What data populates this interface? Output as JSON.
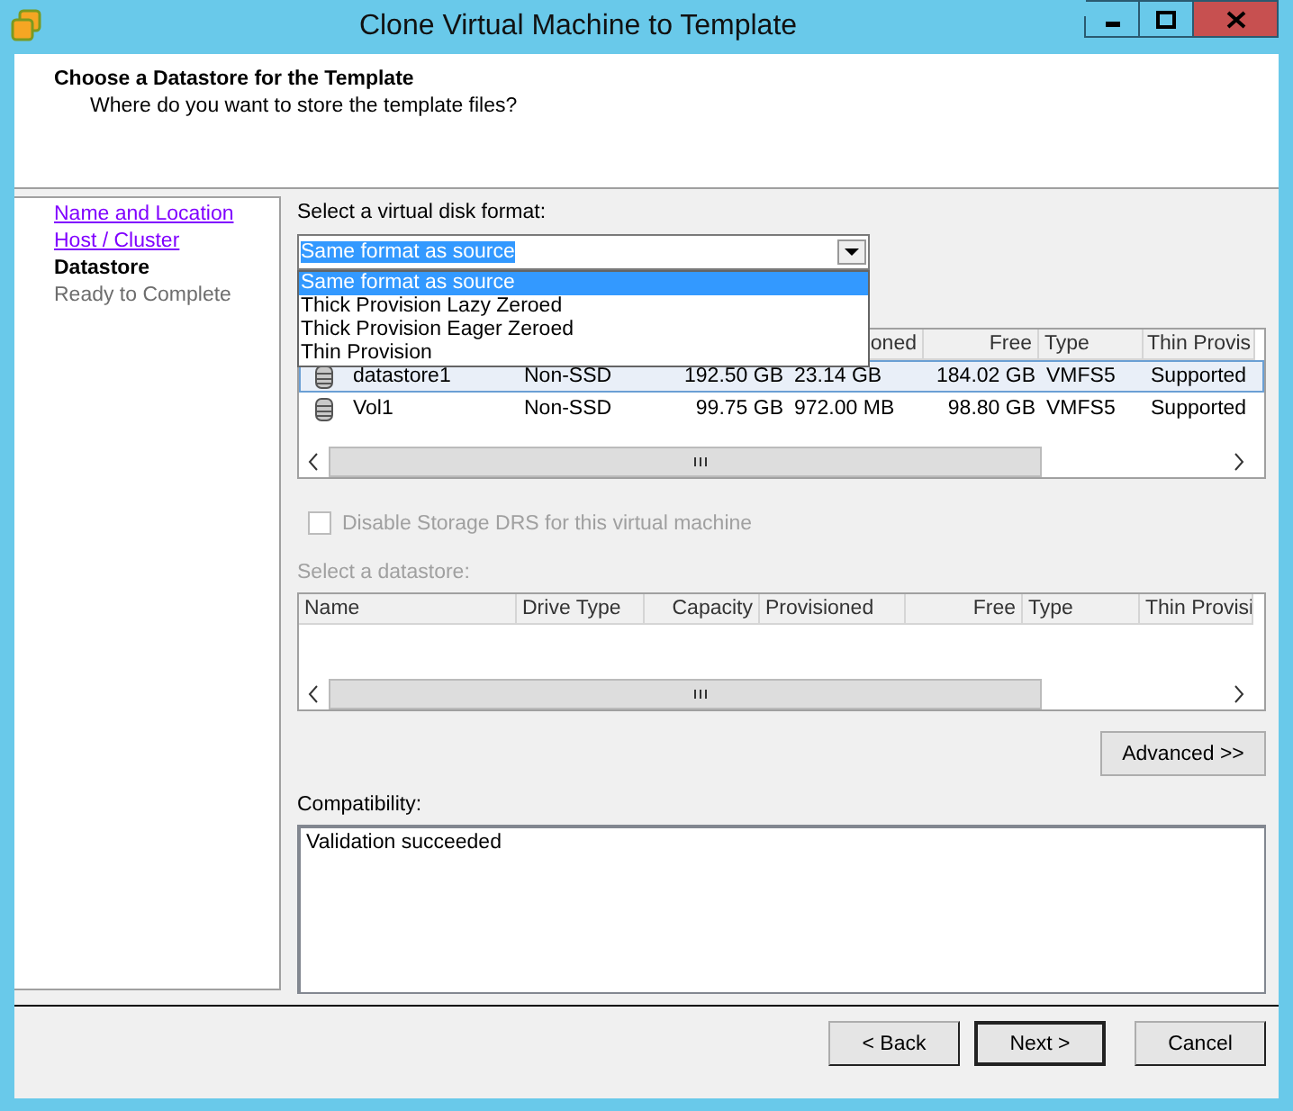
{
  "window": {
    "title": "Clone Virtual Machine to Template"
  },
  "header": {
    "title": "Choose a Datastore for the Template",
    "subtitle": "Where do you want to store the template files?"
  },
  "nav": [
    {
      "label": "Name and Location",
      "kind": "visited"
    },
    {
      "label": "Host / Cluster",
      "kind": "visited"
    },
    {
      "label": "Datastore",
      "kind": "current"
    },
    {
      "label": "Ready to Complete",
      "kind": "upcoming"
    }
  ],
  "disk_format": {
    "label": "Select a virtual disk format:",
    "value": "Same format as source",
    "expanded": true,
    "options": [
      {
        "label": "Same format as source",
        "selected": true
      },
      {
        "label": "Thick Provision Lazy Zeroed",
        "selected": false
      },
      {
        "label": "Thick Provision Eager Zeroed",
        "selected": false
      },
      {
        "label": "Thin Provision",
        "selected": false
      }
    ]
  },
  "datastore_table": {
    "columns": [
      "",
      "",
      "",
      "oned",
      "Free",
      "Type",
      "Thin Provis"
    ],
    "rows": [
      {
        "selected": true,
        "cells": [
          "datastore1",
          "Non-SSD",
          "192.50 GB",
          "23.14 GB",
          "184.02 GB",
          "VMFS5",
          "Supported"
        ]
      },
      {
        "selected": false,
        "cells": [
          "Vol1",
          "Non-SSD",
          "99.75 GB",
          "972.00 MB",
          "98.80 GB",
          "VMFS5",
          "Supported"
        ]
      }
    ]
  },
  "storage_drs": {
    "label": "Disable Storage DRS for this virtual machine",
    "checked": false,
    "disabled": true
  },
  "datastore_select": {
    "label": "Select a datastore:",
    "columns": [
      "Name",
      "Drive Type",
      "Capacity",
      "Provisioned",
      "Free",
      "Type",
      "Thin Provisi"
    ]
  },
  "advanced_button": "Advanced >>",
  "compatibility": {
    "label": "Compatibility:",
    "text": "Validation succeeded"
  },
  "buttons": [
    {
      "label": "< Back",
      "default": false
    },
    {
      "label": "Next >",
      "default": true
    },
    {
      "label": "Cancel",
      "default": false
    }
  ]
}
